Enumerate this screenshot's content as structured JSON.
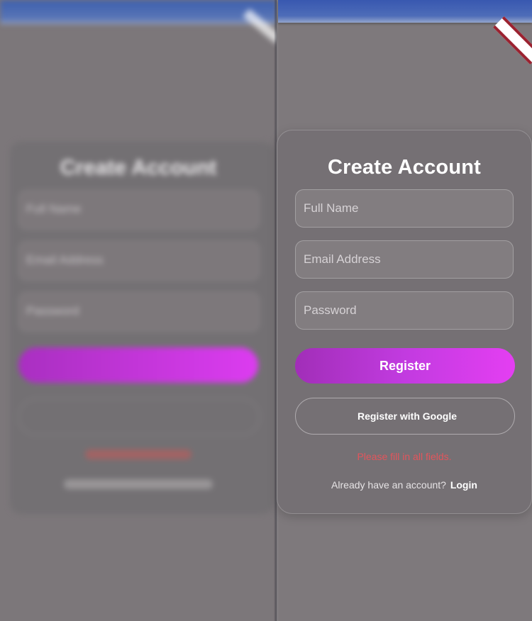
{
  "form": {
    "title": "Create Account",
    "full_name_placeholder": "Full Name",
    "full_name_value": "",
    "email_placeholder": "Email Address",
    "email_value": "",
    "password_placeholder": "Password",
    "password_value": "",
    "register_label": "Register",
    "google_label": "Register with Google",
    "error_message": "Please fill in all fields.",
    "login_prompt": "Already have an account?",
    "login_link": "Login"
  },
  "colors": {
    "accent_start": "#a12eb8",
    "accent_end": "#e43ef2",
    "error": "#e2555c",
    "top_bar": "#3858b0",
    "debug_ribbon": "#9b2230"
  },
  "icons": {
    "debug_banner": "debug-ribbon"
  }
}
